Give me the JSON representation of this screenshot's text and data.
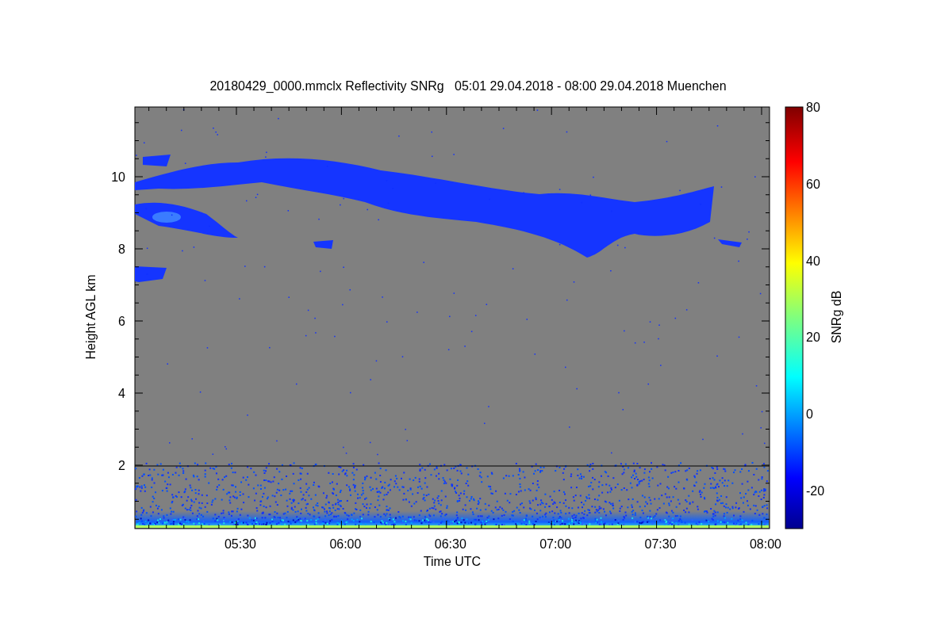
{
  "plot": {
    "title": "20180429_0000.mmclx Reflectivity SNRg   05:01 29.04.2018 - 08:00 29.04.2018 Muenchen",
    "x_axis": {
      "label": "Time UTC",
      "ticks": [
        "05:30",
        "06:00",
        "06:30",
        "07:00",
        "07:30",
        "08:00"
      ]
    },
    "y_axis": {
      "label": "Height AGL km",
      "ticks": [
        "10",
        "8",
        "6",
        "4",
        "2"
      ]
    },
    "colorbar": {
      "label": "SNRg dB",
      "ticks": [
        "80",
        "60",
        "40",
        "20",
        "0",
        "-20"
      ]
    }
  }
}
